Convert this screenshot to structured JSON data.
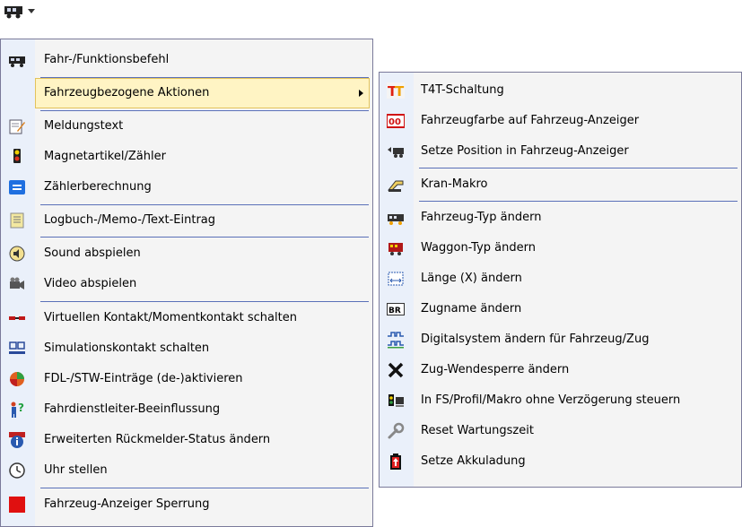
{
  "toolbar": {
    "button_icon": "locomotive-icon"
  },
  "main_menu": {
    "items": [
      {
        "label": "Fahr-/Funktionsbefehl",
        "icon": "locomotive-icon"
      },
      {
        "label": "Fahrzeugbezogene Aktionen",
        "icon": "",
        "highlighted": true,
        "has_submenu": true
      },
      {
        "label": "Meldungstext",
        "icon": "message-edit-icon"
      },
      {
        "label": "Magnetartikel/Zähler",
        "icon": "signal-icon"
      },
      {
        "label": "Zählerberechnung",
        "icon": "equals-icon"
      },
      {
        "label": "Logbuch-/Memo-/Text-Eintrag",
        "icon": "logbook-icon"
      },
      {
        "label": "Sound abspielen",
        "icon": "speaker-icon"
      },
      {
        "label": "Video abspielen",
        "icon": "video-camera-icon"
      },
      {
        "label": "Virtuellen Kontakt/Momentkontakt schalten",
        "icon": "contact-icon"
      },
      {
        "label": "Simulationskontakt schalten",
        "icon": "simulation-contact-icon"
      },
      {
        "label": "FDL-/STW-Einträge (de-)aktivieren",
        "icon": "color-ball-icon"
      },
      {
        "label": "Fahrdienstleiter-Beeinflussung",
        "icon": "dispatcher-icon"
      },
      {
        "label": "Erweiterten Rückmelder-Status ändern",
        "icon": "info-icon"
      },
      {
        "label": "Uhr stellen",
        "icon": "clock-icon"
      },
      {
        "label": "Fahrzeug-Anzeiger Sperrung",
        "icon": "red-square-icon"
      }
    ]
  },
  "sub_menu": {
    "items": [
      {
        "label": "T4T-Schaltung",
        "icon": "t4t-icon"
      },
      {
        "label": "Fahrzeugfarbe auf Fahrzeug-Anzeiger",
        "icon": "color-display-icon"
      },
      {
        "label": "Setze Position in Fahrzeug-Anzeiger",
        "icon": "position-icon"
      },
      {
        "label": "Kran-Makro",
        "icon": "crane-icon"
      },
      {
        "label": "Fahrzeug-Typ ändern",
        "icon": "vehicle-type-icon"
      },
      {
        "label": "Waggon-Typ ändern",
        "icon": "wagon-type-icon"
      },
      {
        "label": "Länge (X) ändern",
        "icon": "length-icon"
      },
      {
        "label": "Zugname ändern",
        "icon": "train-name-icon"
      },
      {
        "label": "Digitalsystem ändern für Fahrzeug/Zug",
        "icon": "digital-system-icon"
      },
      {
        "label": "Zug-Wendesperre ändern",
        "icon": "reverse-lock-icon"
      },
      {
        "label": "In FS/Profil/Makro ohne Verzögerung steuern",
        "icon": "no-delay-icon"
      },
      {
        "label": "Reset Wartungszeit",
        "icon": "wrench-icon"
      },
      {
        "label": "Setze Akkuladung",
        "icon": "battery-icon"
      }
    ],
    "badges": {
      "t4t": "T",
      "color_display": "00",
      "train_name": "BR"
    }
  },
  "colors": {
    "highlight": "#fff4c4",
    "gutter": "#eaf0fa",
    "separator": "#5a70b8"
  }
}
